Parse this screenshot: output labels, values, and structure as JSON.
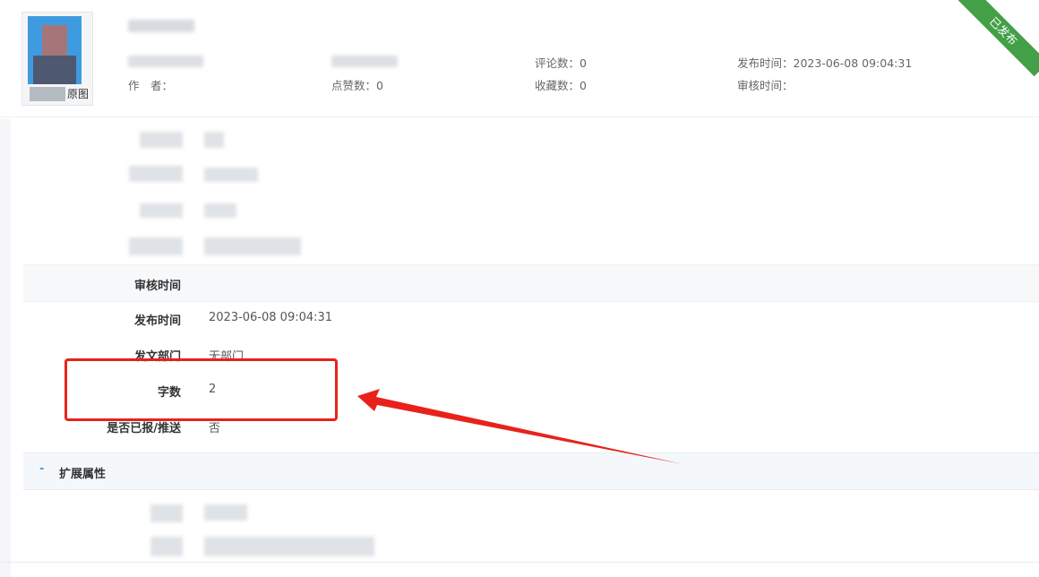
{
  "header": {
    "thumbnail": {
      "view_label": "原图"
    },
    "meta": [
      {
        "label": "评论数：",
        "value": "0"
      },
      {
        "label": "发布时间：",
        "value": "2023-06-08 09:04:31"
      },
      {
        "label": "作　者：",
        "value": ""
      },
      {
        "label": "点赞数：",
        "value": "0"
      },
      {
        "label": "收藏数：",
        "value": "0"
      },
      {
        "label": "审核时间：",
        "value": ""
      }
    ],
    "status_ribbon": "已发布"
  },
  "details": {
    "rows": [
      {
        "label": "审核时间",
        "value": ""
      },
      {
        "label": "发布时间",
        "value": "2023-06-08 09:04:31"
      },
      {
        "label": "发文部门",
        "value": "无部门"
      },
      {
        "label": "字数",
        "value": "2"
      },
      {
        "label": "是否已报/推送",
        "value": "否"
      }
    ]
  },
  "extended": {
    "toggle": "-",
    "title": "扩展属性"
  },
  "colors": {
    "ribbon": "#43a047",
    "highlight": "#e8221b",
    "accent": "#4b9be0"
  }
}
